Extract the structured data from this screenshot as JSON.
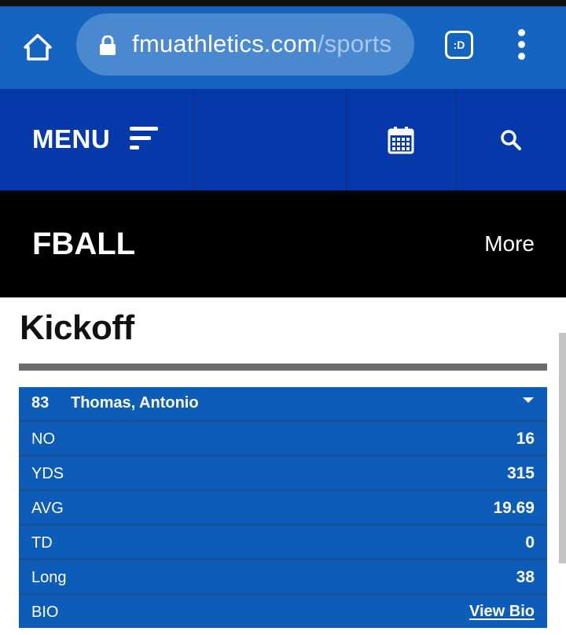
{
  "browser": {
    "url_domain": "fmuathletics.com",
    "url_path": "/sports",
    "tab_label": ":D"
  },
  "site_nav": {
    "menu_label": "MENU"
  },
  "sport_header": {
    "title": "FBALL",
    "more_label": "More"
  },
  "page": {
    "heading": "Kickoff"
  },
  "player": {
    "number": "83",
    "name": "Thomas, Antonio",
    "stats": [
      {
        "label": "NO",
        "value": "16"
      },
      {
        "label": "YDS",
        "value": "315"
      },
      {
        "label": "AVG",
        "value": "19.69"
      },
      {
        "label": "TD",
        "value": "0"
      },
      {
        "label": "Long",
        "value": "38"
      }
    ],
    "bio_label": "BIO",
    "bio_link": "View Bio"
  },
  "colors": {
    "browser_bar": "#1565c0",
    "site_nav": "#0538a8",
    "sport_header": "#000000",
    "stats_card": "#0c5cb8"
  }
}
